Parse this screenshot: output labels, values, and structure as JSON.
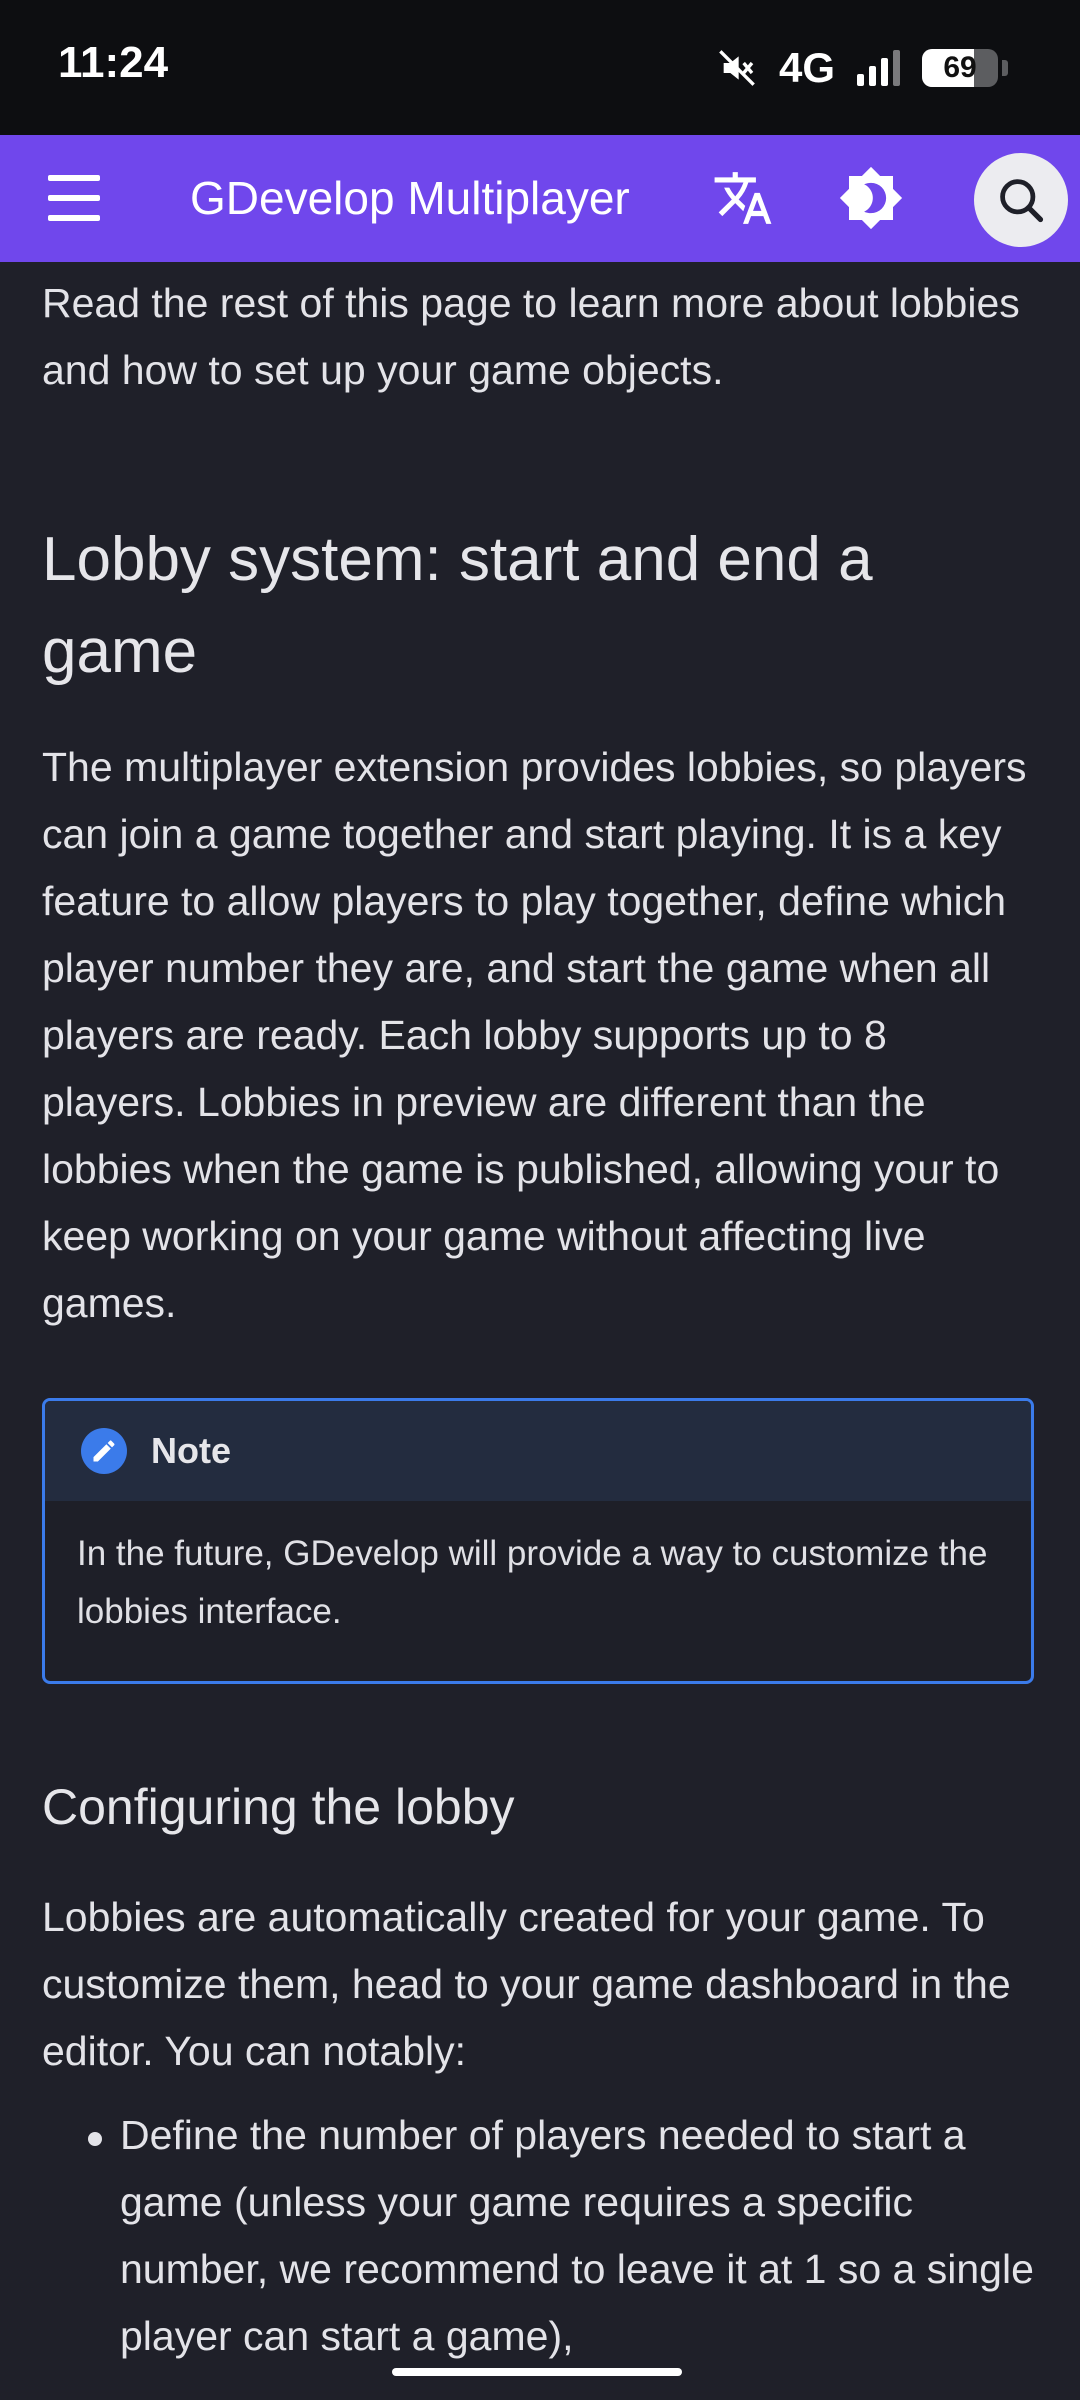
{
  "status_bar": {
    "time": "11:24",
    "network": "4G",
    "battery_level": "69",
    "battery_fraction": 0.69,
    "icons": [
      "mute-icon",
      "signal-icon",
      "battery-icon"
    ]
  },
  "navbar": {
    "title": "GDevelop Multiplayer",
    "icons": [
      "menu-icon",
      "translate-icon",
      "theme-toggle-icon",
      "search-icon"
    ],
    "accent_color": "#7047ec"
  },
  "content": {
    "intro": "Read the rest of this page to learn more about lobbies and how to set up your game objects.",
    "heading": "Lobby system: start and end a game",
    "paragraph1": "The multiplayer extension provides lobbies, so players can join a game together and start playing. It is a key feature to allow players to play together, define which player number they are, and start the game when all players are ready. Each lobby supports up to 8 players. Lobbies in preview are different than the lobbies when the game is published, allowing your to keep working on your game without affecting live games.",
    "note": {
      "title": "Note",
      "body": "In the future, GDevelop will provide a way to customize the lobbies interface.",
      "icon": "pencil-icon",
      "border_color": "#3b7bea"
    },
    "subheading": "Configuring the lobby",
    "paragraph2": "Lobbies are automatically created for your game. To customize them, head to your game dashboard in the editor. You can notably:",
    "list": [
      "Define the number of players needed to start a game (unless your game requires a specific number, we recommend to leave it at 1 so a single player can start a game),"
    ]
  },
  "colors": {
    "background": "#1f2029",
    "status_bar": "#0d0e11",
    "text": "#e3e3e8"
  }
}
